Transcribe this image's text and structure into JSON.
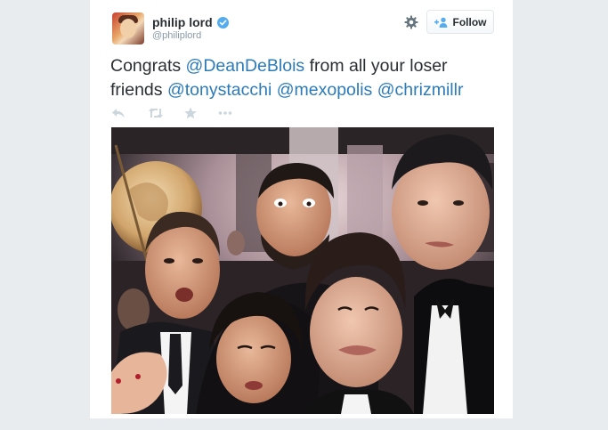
{
  "tweet": {
    "author": {
      "display_name": "philip lord",
      "handle": "@philiplord",
      "verified": true
    },
    "follow_label": "Follow",
    "text_segments": [
      {
        "text": "Congrats ",
        "type": "text"
      },
      {
        "text": "@DeanDeBlois",
        "type": "mention"
      },
      {
        "text": " from all your loser friends ",
        "type": "text"
      },
      {
        "text": "@tonystacchi",
        "type": "mention"
      },
      {
        "text": " ",
        "type": "text"
      },
      {
        "text": "@mexopolis",
        "type": "mention"
      },
      {
        "text": " ",
        "type": "text"
      },
      {
        "text": "@chrizmillr",
        "type": "mention"
      }
    ],
    "actions": [
      "reply-icon",
      "retweet-icon",
      "favorite-icon",
      "more-icon"
    ],
    "colors": {
      "mention": "#2b7bb9",
      "text": "#292f33",
      "handle": "#8899a6",
      "verified": "#55acee",
      "icon": "#ccd6dd",
      "background": "#e9ecef"
    }
  }
}
